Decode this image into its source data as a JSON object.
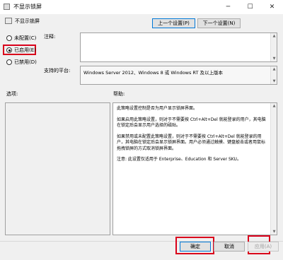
{
  "window": {
    "title": "不显示锁屏"
  },
  "header": {
    "setting_title": "不显示锁屏",
    "prev_button": "上一个设置(P)",
    "next_button": "下一个设置(N)"
  },
  "options": [
    {
      "label": "未配置(C)",
      "selected": false
    },
    {
      "label": "已启用(E)",
      "selected": true
    },
    {
      "label": "已禁用(D)",
      "selected": false
    }
  ],
  "comment": {
    "label": "注释:",
    "value": ""
  },
  "platform": {
    "label": "支持的平台:",
    "value": "Windows Server 2012、Windows 8 或 Windows RT 及以上版本"
  },
  "sections": {
    "options_label": "选项:",
    "help_label": "帮助:"
  },
  "help_paragraphs": [
    "此策略设置控制是否为用户显示锁屏界面。",
    "如果启用此策略设置，则对于不需要按 Ctrl+Alt+Del 就能登录的用户，其电脑在锁定后会显示用户选择的磁贴。",
    "如果禁用或未配置此策略设置，则对于不需要按 Ctrl+Alt+Del 就能登录的用户，其电脑在锁定后会显示锁屏界面。用户必须通过触摸、键盘敲击或者用鼠标拖拽锁屏的方式取消锁屏界面。",
    "注意: 此设置仅适用于 Enterprise、Education 和 Server SKU。"
  ],
  "footer": {
    "ok": "确定",
    "cancel": "取消",
    "apply": "应用(A)"
  },
  "colors": {
    "highlight": "#d9001b",
    "focus": "#0078d7"
  }
}
